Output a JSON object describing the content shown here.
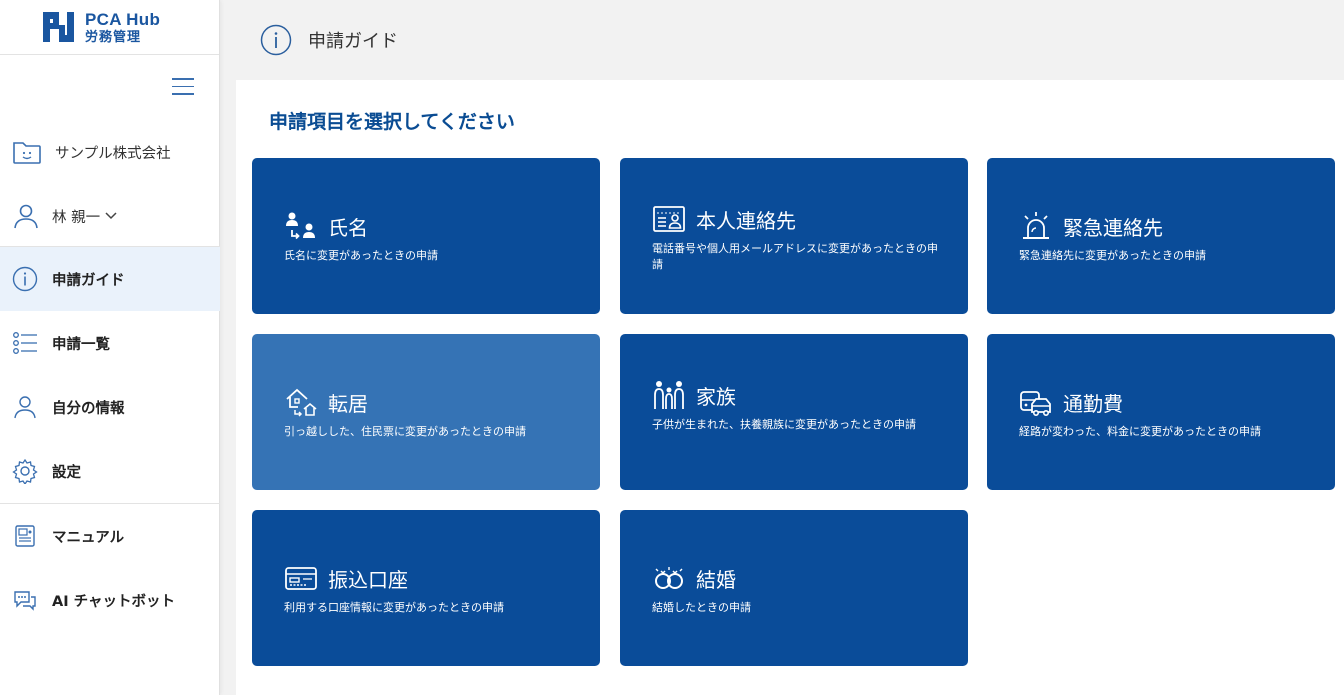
{
  "logo": {
    "title": "PCA Hub",
    "subtitle": "労務管理"
  },
  "sidebar": {
    "company": "サンプル株式会社",
    "user": "林 親一",
    "items": [
      {
        "label": "申請ガイド",
        "icon": "info-icon",
        "active": true
      },
      {
        "label": "申請一覧",
        "icon": "list-icon"
      },
      {
        "label": "自分の情報",
        "icon": "person-icon"
      },
      {
        "label": "設定",
        "icon": "gear-icon"
      },
      {
        "label": "マニュアル",
        "icon": "manual-icon"
      },
      {
        "label": "AI チャットボット",
        "icon": "chatbot-icon"
      }
    ]
  },
  "header": {
    "title": "申請ガイド"
  },
  "main": {
    "heading": "申請項目を選択してください",
    "cards": [
      {
        "title": "氏名",
        "desc": "氏名に変更があったときの申請",
        "icon": "name-change-icon"
      },
      {
        "title": "本人連絡先",
        "desc": "電話番号や個人用メールアドレスに変更があったときの申請",
        "icon": "contact-card-icon"
      },
      {
        "title": "緊急連絡先",
        "desc": "緊急連絡先に変更があったときの申請",
        "icon": "alarm-icon"
      },
      {
        "title": "転居",
        "desc": "引っ越しした、住民票に変更があったときの申請",
        "icon": "house-move-icon"
      },
      {
        "title": "家族",
        "desc": "子供が生まれた、扶養親族に変更があったときの申請",
        "icon": "family-icon"
      },
      {
        "title": "通勤費",
        "desc": "経路が変わった、料金に変更があったときの申請",
        "icon": "commute-icon"
      },
      {
        "title": "振込口座",
        "desc": "利用する口座情報に変更があったときの申請",
        "icon": "bank-card-icon"
      },
      {
        "title": "結婚",
        "desc": "結婚したときの申請",
        "icon": "rings-icon"
      }
    ]
  },
  "colors": {
    "brand": "#1a56a0",
    "card": "#0a4c99",
    "card_hover": "#3573b5",
    "active_nav": "#eaf2fb"
  }
}
